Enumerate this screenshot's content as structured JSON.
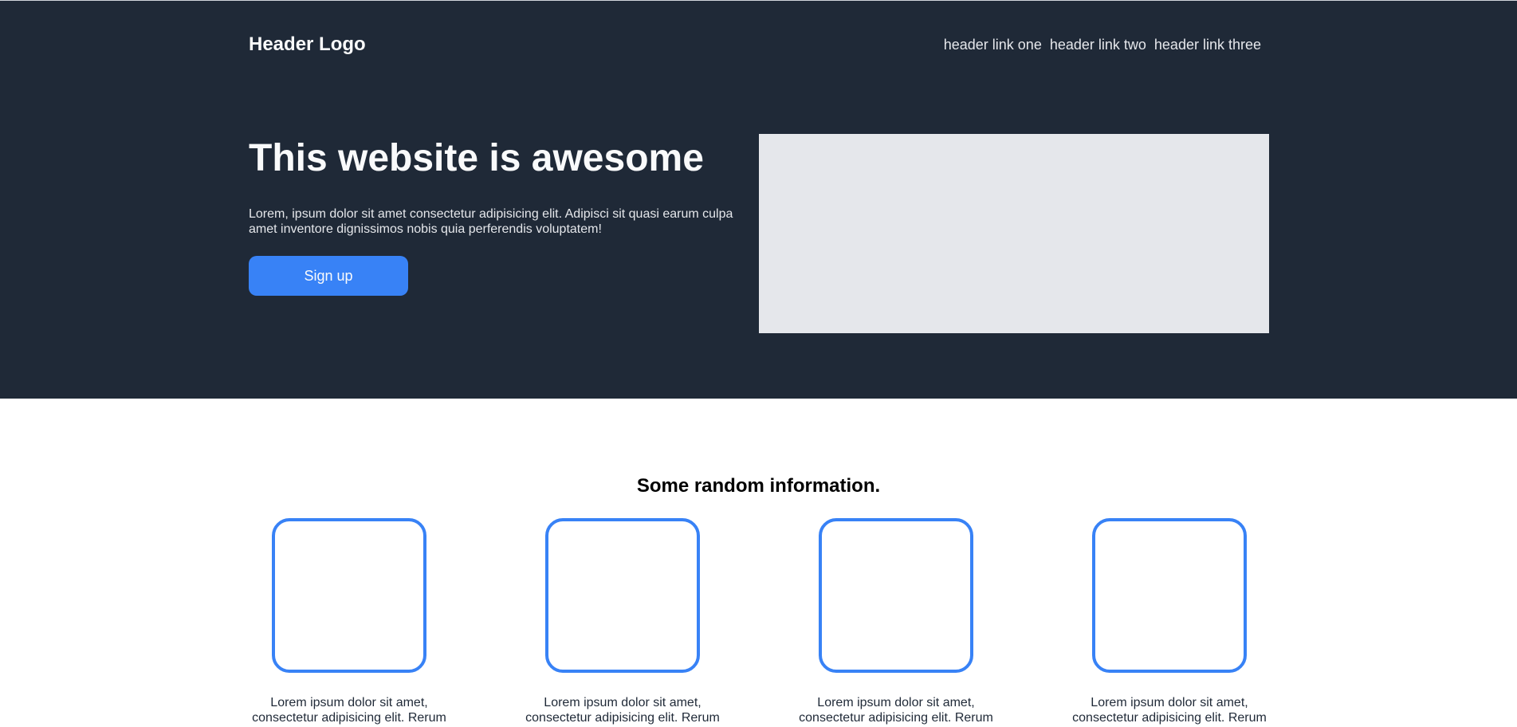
{
  "header": {
    "logo": "Header Logo",
    "links": [
      {
        "label": "header link one"
      },
      {
        "label": "header link two"
      },
      {
        "label": "header link three"
      }
    ]
  },
  "hero": {
    "title": "This website is awesome",
    "body": "Lorem, ipsum dolor sit amet consectetur adipisicing elit. Adipisci sit quasi earum culpa amet inventore dignissimos nobis quia perferendis voluptatem!",
    "cta_label": "Sign up"
  },
  "info": {
    "title": "Some random information.",
    "cards": [
      {
        "text": "Lorem ipsum dolor sit amet, consectetur adipisicing elit. Rerum"
      },
      {
        "text": "Lorem ipsum dolor sit amet, consectetur adipisicing elit. Rerum"
      },
      {
        "text": "Lorem ipsum dolor sit amet, consectetur adipisicing elit. Rerum"
      },
      {
        "text": "Lorem ipsum dolor sit amet, consectetur adipisicing elit. Rerum"
      }
    ]
  },
  "colors": {
    "hero_background": "#1f2937",
    "accent": "#3882f6",
    "image_placeholder": "#e5e7eb"
  }
}
